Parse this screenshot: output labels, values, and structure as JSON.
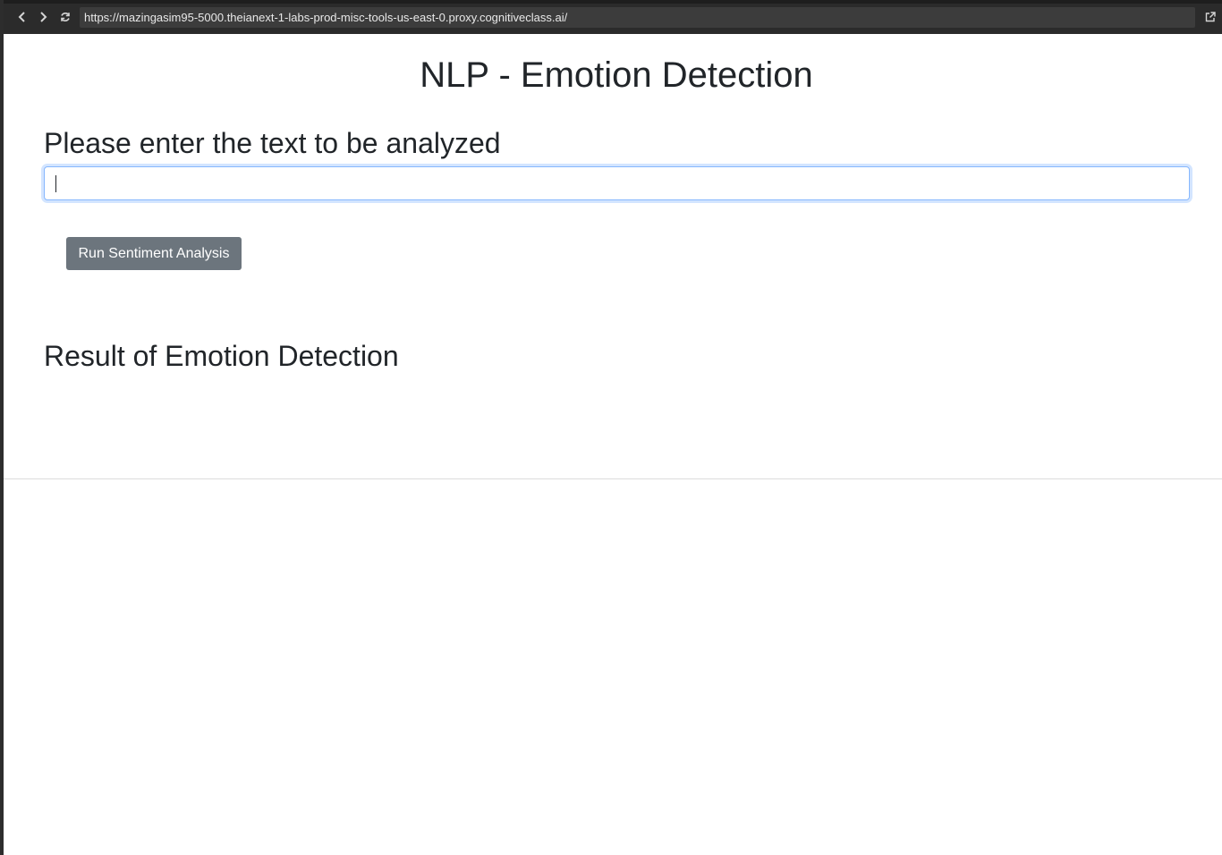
{
  "browser": {
    "url": "https://mazingasim95-5000.theianext-1-labs-prod-misc-tools-us-east-0.proxy.cognitiveclass.ai/",
    "back_icon": "chevron-left-icon",
    "forward_icon": "chevron-right-icon",
    "reload_icon": "reload-icon",
    "external_icon": "open-external-icon"
  },
  "page": {
    "title": "NLP - Emotion Detection",
    "prompt_heading": "Please enter the text to be analyzed",
    "input": {
      "value": "",
      "placeholder": ""
    },
    "run_button_label": "Run Sentiment Analysis",
    "result_heading": "Result of Emotion Detection",
    "result_text": ""
  },
  "colors": {
    "toolbar_bg": "#2b2b2b",
    "url_bar_bg": "#3c3c3c",
    "button_bg": "#6c757d",
    "input_focus_border": "#86b7fe",
    "heading_text": "#212529"
  }
}
